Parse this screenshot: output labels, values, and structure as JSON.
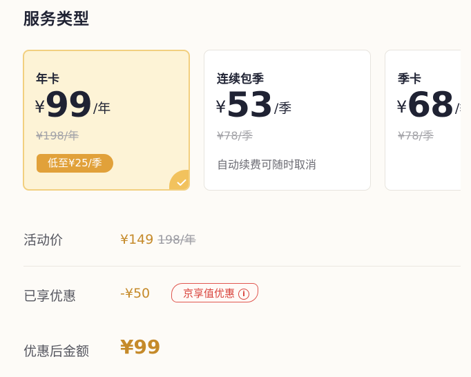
{
  "section": {
    "title": "服务类型"
  },
  "plans": [
    {
      "name": "年卡",
      "currency": "¥",
      "amount": "99",
      "unit": "/年",
      "original": "¥198/年",
      "badge": "低至¥25/季",
      "selected": true
    },
    {
      "name": "连续包季",
      "currency": "¥",
      "amount": "53",
      "unit": "/季",
      "original": "¥78/季",
      "note": "自动续费可随时取消",
      "selected": false
    },
    {
      "name": "季卡",
      "currency": "¥",
      "amount": "68",
      "unit": "/季",
      "original": "¥78/季",
      "selected": false
    }
  ],
  "summary": {
    "activity_label": "活动价",
    "activity_price": "¥149",
    "activity_original": "198/年",
    "discount_label": "已享优惠",
    "discount_value": "-¥50",
    "discount_tag": "京享值优惠",
    "discount_tag_icon": "info-icon",
    "final_label": "优惠后金额",
    "final_value": "¥99"
  },
  "colors": {
    "accent_gold": "#c58a2a",
    "badge_gold": "#e1a13a",
    "selected_bg": "#fdf3d6",
    "selected_border": "#f2cf7f",
    "promo_red": "#d9443d"
  }
}
